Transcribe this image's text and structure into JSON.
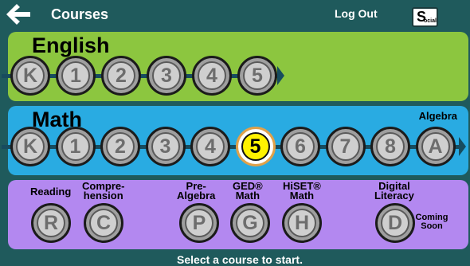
{
  "header": {
    "back_icon": "back-arrow-icon",
    "title": "Courses",
    "logout": "Log Out",
    "social_big": "S",
    "social_small": "ocial"
  },
  "english": {
    "title": "English",
    "levels": [
      "K",
      "1",
      "2",
      "3",
      "4",
      "5"
    ]
  },
  "math": {
    "title": "Math",
    "algebra_label": "Algebra",
    "levels": [
      "K",
      "1",
      "2",
      "3",
      "4",
      "5",
      "6",
      "7",
      "8",
      "A"
    ],
    "selected": "5"
  },
  "other": {
    "courses": [
      {
        "label": "Reading",
        "glyph": "R"
      },
      {
        "label": "Compre-\nhension",
        "glyph": "C"
      },
      {
        "label": "Pre-\nAlgebra",
        "glyph": "P"
      },
      {
        "label": "GED®\nMath",
        "glyph": "G"
      },
      {
        "label": "HiSET®\nMath",
        "glyph": "H"
      },
      {
        "label": "Digital\nLiteracy",
        "glyph": "D"
      }
    ],
    "coming_soon": "Coming\nSoon"
  },
  "footer": "Select a course to start.",
  "colors": {
    "background": "#1f5a5c",
    "english": "#8cc63f",
    "math": "#29abe2",
    "other": "#b388f0",
    "selected": "#fff200"
  }
}
